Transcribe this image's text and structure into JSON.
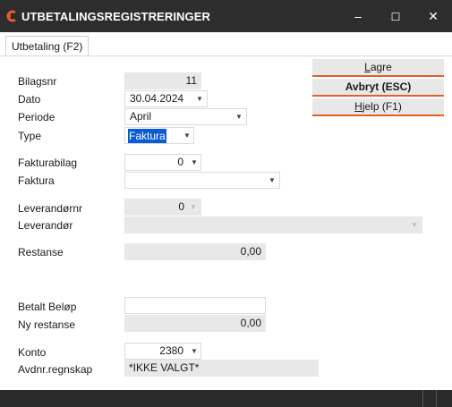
{
  "window": {
    "title": "UTBETALINGSREGISTRERINGER",
    "minimize_glyph": "–",
    "maximize_glyph": "☐",
    "close_glyph": "✕",
    "accent": "#e0602a",
    "titlebar_bg": "#2d2d2d"
  },
  "tabs": [
    {
      "label": "Utbetaling (F2)",
      "active": true
    }
  ],
  "buttons": {
    "save_accel": "L",
    "save_rest": "agre",
    "cancel": "Avbryt (ESC)",
    "help_accel": "H",
    "help_rest": "jelp (F1)"
  },
  "form": {
    "bilagsnr": {
      "label": "Bilagsnr",
      "value": "11"
    },
    "dato": {
      "label": "Dato",
      "value": "30.04.2024"
    },
    "periode": {
      "label": "Periode",
      "value": "April"
    },
    "type": {
      "label": "Type",
      "value": "Faktura"
    },
    "fakturabilag": {
      "label": "Fakturabilag",
      "value": "0"
    },
    "faktura": {
      "label": "Faktura",
      "value": ""
    },
    "leverandornr": {
      "label": "Leverandørnr",
      "value": "0"
    },
    "leverandor": {
      "label": "Leverandør",
      "value": ""
    },
    "restanse": {
      "label": "Restanse",
      "value": "0,00"
    },
    "betalt_belop": {
      "label": "Betalt Beløp",
      "value": ""
    },
    "ny_restanse": {
      "label": "Ny restanse",
      "value": "0,00"
    },
    "konto": {
      "label": "Konto",
      "value": "2380"
    },
    "avdnr": {
      "label": "Avdnr.regnskap",
      "value": "*IKKE VALGT*"
    }
  },
  "dropdown_glyph": "▼"
}
